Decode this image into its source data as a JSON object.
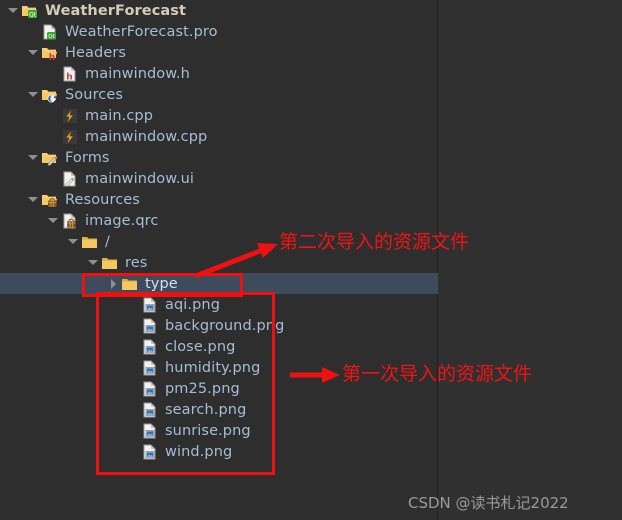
{
  "window": {
    "title": "Qt Creator Project Tree",
    "background_color": "#2e2e2e",
    "accent_color": "#ee1111",
    "text_color": "#a6bdd4",
    "root_text_color": "#d5cdb8",
    "selection_color": "#3d4b5c"
  },
  "tree": {
    "items": [
      {
        "label": "WeatherForecast",
        "icon": "qt-project-folder-icon",
        "indent": 0,
        "expander": "open",
        "root": true,
        "selected": false
      },
      {
        "label": "WeatherForecast.pro",
        "icon": "qt-pro-file-icon",
        "indent": 1,
        "expander": "none",
        "root": false,
        "selected": false
      },
      {
        "label": "Headers",
        "icon": "headers-folder-icon",
        "indent": 1,
        "expander": "open",
        "root": false,
        "selected": false
      },
      {
        "label": "mainwindow.h",
        "icon": "header-file-icon",
        "indent": 2,
        "expander": "none",
        "root": false,
        "selected": false
      },
      {
        "label": "Sources",
        "icon": "sources-folder-icon",
        "indent": 1,
        "expander": "open",
        "root": false,
        "selected": false
      },
      {
        "label": "main.cpp",
        "icon": "cpp-file-icon",
        "indent": 2,
        "expander": "none",
        "root": false,
        "selected": false
      },
      {
        "label": "mainwindow.cpp",
        "icon": "cpp-file-icon",
        "indent": 2,
        "expander": "none",
        "root": false,
        "selected": false
      },
      {
        "label": "Forms",
        "icon": "forms-folder-icon",
        "indent": 1,
        "expander": "open",
        "root": false,
        "selected": false
      },
      {
        "label": "mainwindow.ui",
        "icon": "ui-file-icon",
        "indent": 2,
        "expander": "none",
        "root": false,
        "selected": false
      },
      {
        "label": "Resources",
        "icon": "resources-folder-icon",
        "indent": 1,
        "expander": "open",
        "root": false,
        "selected": false
      },
      {
        "label": "image.qrc",
        "icon": "qrc-file-icon",
        "indent": 2,
        "expander": "open",
        "root": false,
        "selected": false
      },
      {
        "label": "/",
        "icon": "folder-icon",
        "indent": 3,
        "expander": "open",
        "root": false,
        "selected": false
      },
      {
        "label": "res",
        "icon": "folder-icon",
        "indent": 4,
        "expander": "open",
        "root": false,
        "selected": false
      },
      {
        "label": "type",
        "icon": "folder-icon",
        "indent": 5,
        "expander": "closed",
        "root": false,
        "selected": true
      },
      {
        "label": "aqi.png",
        "icon": "png-file-icon",
        "indent": 6,
        "expander": "none",
        "root": false,
        "selected": false
      },
      {
        "label": "background.png",
        "icon": "png-file-icon",
        "indent": 6,
        "expander": "none",
        "root": false,
        "selected": false
      },
      {
        "label": "close.png",
        "icon": "png-file-icon",
        "indent": 6,
        "expander": "none",
        "root": false,
        "selected": false
      },
      {
        "label": "humidity.png",
        "icon": "png-file-icon",
        "indent": 6,
        "expander": "none",
        "root": false,
        "selected": false
      },
      {
        "label": "pm25.png",
        "icon": "png-file-icon",
        "indent": 6,
        "expander": "none",
        "root": false,
        "selected": false
      },
      {
        "label": "search.png",
        "icon": "png-file-icon",
        "indent": 6,
        "expander": "none",
        "root": false,
        "selected": false
      },
      {
        "label": "sunrise.png",
        "icon": "png-file-icon",
        "indent": 6,
        "expander": "none",
        "root": false,
        "selected": false
      },
      {
        "label": "wind.png",
        "icon": "png-file-icon",
        "indent": 6,
        "expander": "none",
        "root": false,
        "selected": false
      }
    ]
  },
  "annotations": {
    "second_import_label": "第二次导入的资源文件",
    "first_import_label": "第一次导入的资源文件"
  },
  "watermark": {
    "text": "CSDN @读书札记2022"
  }
}
